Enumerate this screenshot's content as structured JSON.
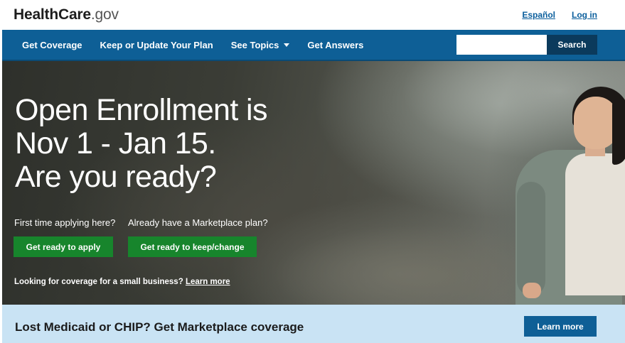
{
  "header": {
    "logo_brand": "HealthCare",
    "logo_tld": ".gov",
    "links": [
      "Español",
      "Log in"
    ]
  },
  "nav": {
    "items": [
      {
        "label": "Get Coverage"
      },
      {
        "label": "Keep or Update Your Plan"
      },
      {
        "label": "See Topics",
        "dropdown": true
      },
      {
        "label": "Get Answers"
      }
    ],
    "search": {
      "placeholder": "",
      "value": "",
      "button_label": "Search"
    }
  },
  "hero": {
    "headline_line1": "Open Enrollment is",
    "headline_line2": "Nov 1 - Jan 15.",
    "headline_line3": "Are you ready?",
    "question_first": "First time applying here?",
    "question_existing": "Already have a Marketplace plan?",
    "cta_apply": "Get ready to apply",
    "cta_keep": "Get ready to keep/change",
    "smallbiz_text": "Looking for coverage for a small business?",
    "smallbiz_link": "Learn more"
  },
  "banner": {
    "text": "Lost Medicaid or CHIP? Get Marketplace coverage",
    "button_label": "Learn more"
  },
  "colors": {
    "nav_bg": "#0e5f96",
    "cta_green": "#17852c",
    "banner_bg": "#c9e3f4",
    "link_blue": "#0a5e9c"
  }
}
